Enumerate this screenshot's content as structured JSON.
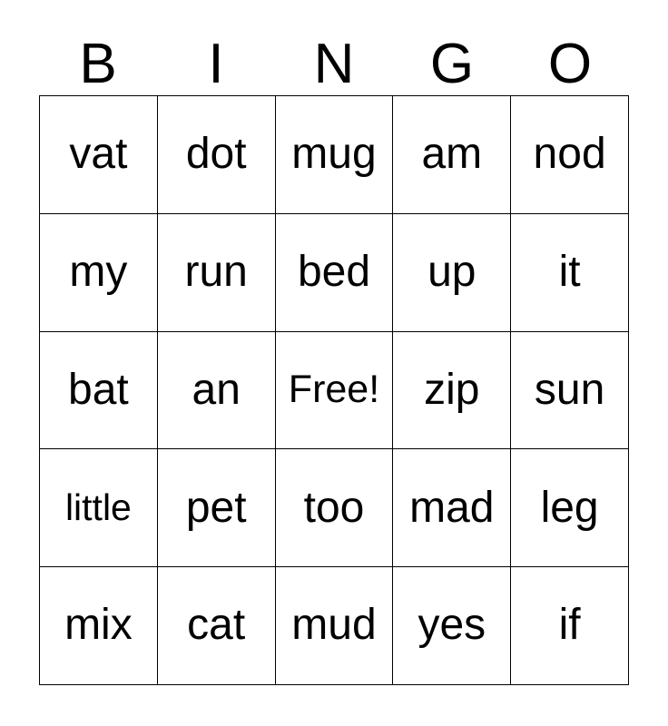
{
  "card": {
    "header": {
      "letters": [
        "B",
        "I",
        "N",
        "G",
        "O"
      ]
    },
    "grid": {
      "rows": 5,
      "columns": 5,
      "border_color": "#000000",
      "background_color": "#ffffff",
      "text_color": "#000000",
      "free_space": "Free!",
      "free_space_position": {
        "row": 3,
        "column": 3
      },
      "cells": [
        [
          "vat",
          "dot",
          "mug",
          "am",
          "nod"
        ],
        [
          "my",
          "run",
          "bed",
          "up",
          "it"
        ],
        [
          "bat",
          "an",
          "Free!",
          "zip",
          "sun"
        ],
        [
          "little",
          "pet",
          "too",
          "mad",
          "leg"
        ],
        [
          "mix",
          "cat",
          "mud",
          "yes",
          "if"
        ]
      ]
    }
  }
}
